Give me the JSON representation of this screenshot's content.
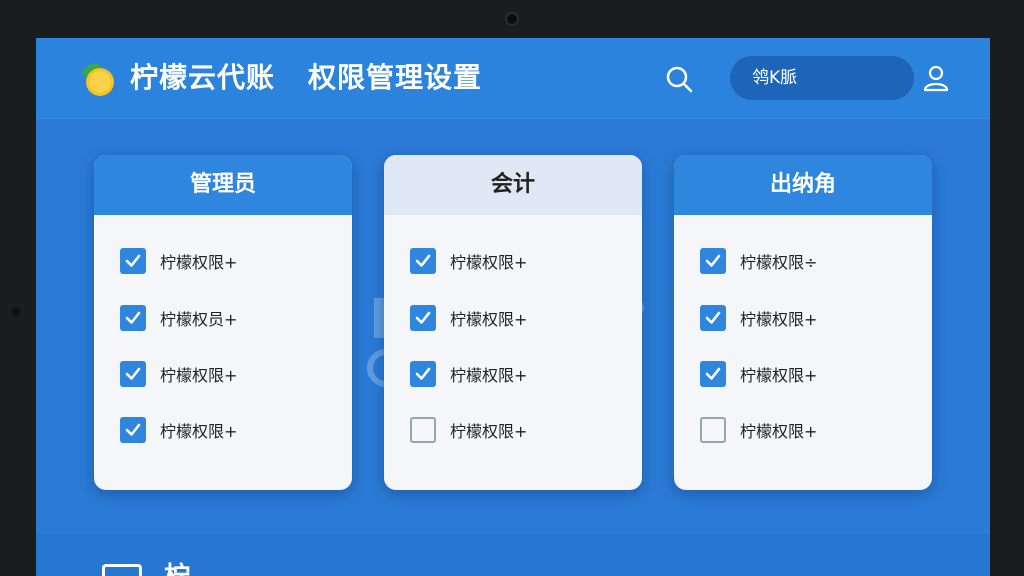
{
  "header": {
    "app_name": "柠檬云代账",
    "page_title": "权限管理设置",
    "user_label": "鸰K脈",
    "icons": {
      "logo": "lemon-logo-icon",
      "search": "search-icon",
      "user": "user-icon"
    }
  },
  "colors": {
    "accent": "#2f86de",
    "background": "#2a7ad6",
    "checkbox_checked": "#2f86de",
    "header_light": "#dfe9f5"
  },
  "roles": [
    {
      "name": "管理员",
      "permissions": [
        {
          "label": "柠檬权限+",
          "checked": true
        },
        {
          "label": "柠檬权员+",
          "checked": true
        },
        {
          "label": "柠檬权限+",
          "checked": true
        },
        {
          "label": "柠檬权限+",
          "checked": true
        }
      ]
    },
    {
      "name": "会计",
      "permissions": [
        {
          "label": "柠檬权限+",
          "checked": true
        },
        {
          "label": "柠檬权限+",
          "checked": true
        },
        {
          "label": "柠檬权限+",
          "checked": true
        },
        {
          "label": "柠檬权限+",
          "checked": false
        }
      ]
    },
    {
      "name": "出纳角",
      "permissions": [
        {
          "label": "柠檬权限÷",
          "checked": true
        },
        {
          "label": "柠檬权限+",
          "checked": true
        },
        {
          "label": "柠檬权限+",
          "checked": true
        },
        {
          "label": "柠檬权限+",
          "checked": false
        }
      ]
    }
  ],
  "footer": {
    "label": "柠",
    "icon": "panel-icon"
  }
}
